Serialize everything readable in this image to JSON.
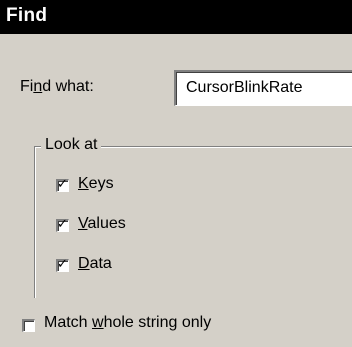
{
  "dialog": {
    "title": "Find"
  },
  "find_what": {
    "label_pre": "Fi",
    "label_ul": "n",
    "label_post": "d what:",
    "value": "CursorBlinkRate"
  },
  "look_at": {
    "legend": "Look at",
    "keys": {
      "ul": "K",
      "rest": "eys",
      "checked": true
    },
    "values": {
      "ul": "V",
      "rest": "alues",
      "checked": true
    },
    "data": {
      "ul": "D",
      "rest": "ata",
      "checked": true
    }
  },
  "match_whole": {
    "pre": "Match ",
    "ul": "w",
    "post": "hole string only",
    "checked": false
  },
  "icons": {
    "checked": "check-mark-icon"
  }
}
